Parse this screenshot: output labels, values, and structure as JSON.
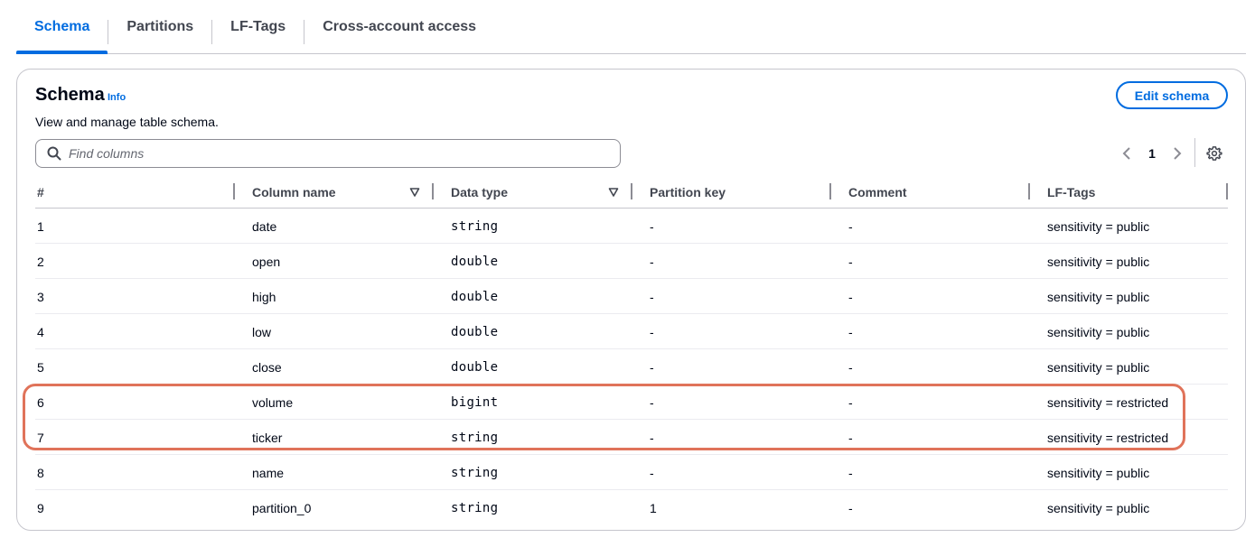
{
  "tabs": [
    {
      "label": "Schema",
      "active": true
    },
    {
      "label": "Partitions",
      "active": false
    },
    {
      "label": "LF-Tags",
      "active": false
    },
    {
      "label": "Cross-account access",
      "active": false
    }
  ],
  "panel": {
    "title": "Schema",
    "info": "Info",
    "description": "View and manage table schema.",
    "edit_button": "Edit schema"
  },
  "search": {
    "placeholder": "Find columns",
    "value": ""
  },
  "pagination": {
    "current_page": "1"
  },
  "icons": {
    "search": "search-icon",
    "prev": "chevron-left-icon",
    "next": "chevron-right-icon",
    "settings": "gear-icon",
    "sort": "sort-down-icon"
  },
  "colors": {
    "accent": "#006ce0",
    "highlight": "#e0735a"
  },
  "table": {
    "headers": [
      "#",
      "Column name",
      "Data type",
      "Partition key",
      "Comment",
      "LF-Tags"
    ],
    "rows": [
      {
        "num": "1",
        "name": "date",
        "type": "string",
        "partition": "-",
        "comment": "-",
        "tags": "sensitivity = public"
      },
      {
        "num": "2",
        "name": "open",
        "type": "double",
        "partition": "-",
        "comment": "-",
        "tags": "sensitivity = public"
      },
      {
        "num": "3",
        "name": "high",
        "type": "double",
        "partition": "-",
        "comment": "-",
        "tags": "sensitivity = public"
      },
      {
        "num": "4",
        "name": "low",
        "type": "double",
        "partition": "-",
        "comment": "-",
        "tags": "sensitivity = public"
      },
      {
        "num": "5",
        "name": "close",
        "type": "double",
        "partition": "-",
        "comment": "-",
        "tags": "sensitivity = public"
      },
      {
        "num": "6",
        "name": "volume",
        "type": "bigint",
        "partition": "-",
        "comment": "-",
        "tags": "sensitivity = restricted"
      },
      {
        "num": "7",
        "name": "ticker",
        "type": "string",
        "partition": "-",
        "comment": "-",
        "tags": "sensitivity = restricted"
      },
      {
        "num": "8",
        "name": "name",
        "type": "string",
        "partition": "-",
        "comment": "-",
        "tags": "sensitivity = public"
      },
      {
        "num": "9",
        "name": "partition_0",
        "type": "string",
        "partition": "1",
        "comment": "-",
        "tags": "sensitivity = public"
      }
    ]
  }
}
